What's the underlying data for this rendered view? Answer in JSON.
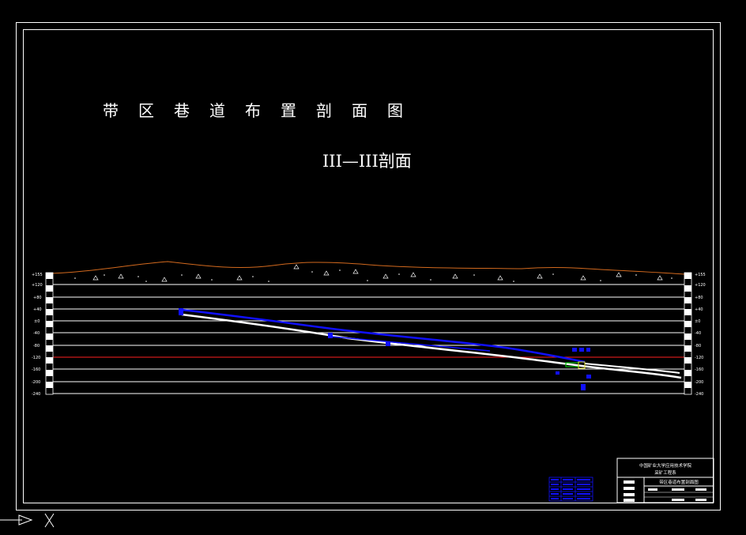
{
  "drawing": {
    "title": "带区巷道布置剖面图",
    "subtitle": "III—III剖面"
  },
  "elevation_labels": [
    "+155",
    "+120",
    "+80",
    "+40",
    "±0",
    "-40",
    "-80",
    "-120",
    "-160",
    "-200",
    "-240"
  ],
  "title_block": {
    "school": "中国矿业大学应用技术学院",
    "department": "采矿工程系",
    "drawing_name": "带区巷道布置剖面图"
  },
  "colors": {
    "background": "#000000",
    "line": "#ffffff",
    "terrain": "#d2691e",
    "roadway_blue": "#1010ff",
    "level_red": "#ff2020",
    "accent_green": "#00c000"
  }
}
